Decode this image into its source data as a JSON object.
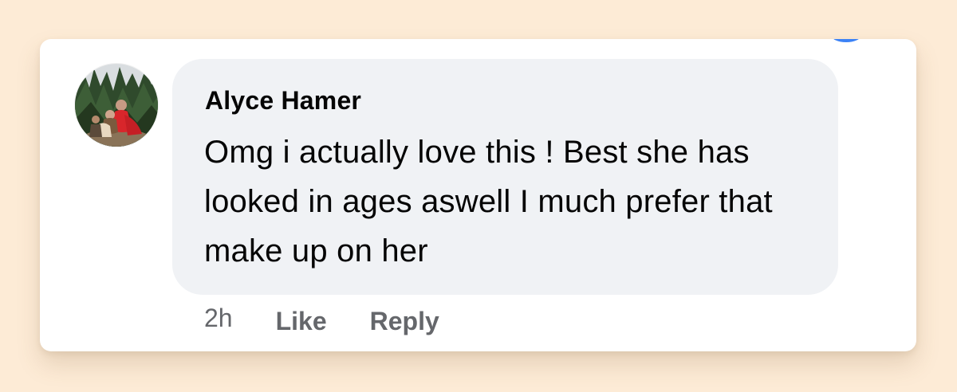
{
  "comment": {
    "author": "Alyce Hamer",
    "text": "Omg i actually love this ! Best she has looked in ages aswell I much prefer that make up on her",
    "timestamp": "2h",
    "like_label": "Like",
    "reply_label": "Reply"
  },
  "colors": {
    "page_background": "#fdebd6",
    "card_background": "#ffffff",
    "bubble_background": "#f0f2f5",
    "primary_text": "#050505",
    "secondary_text": "#65676b"
  },
  "icons": {
    "avatar": "profile-photo"
  }
}
